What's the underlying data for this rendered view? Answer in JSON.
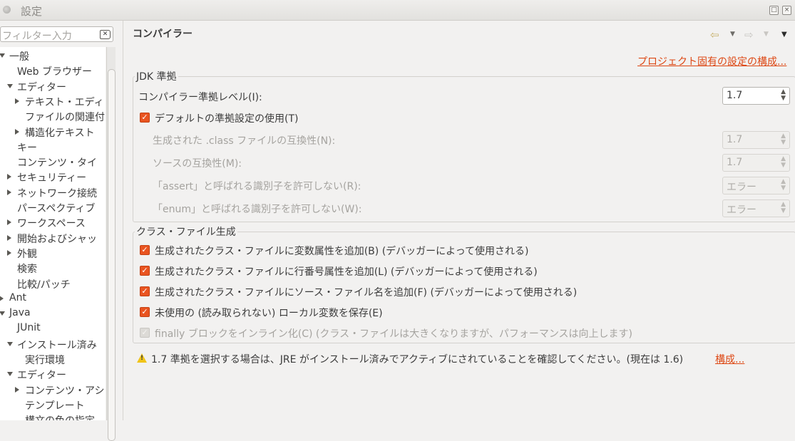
{
  "window": {
    "title": "設定"
  },
  "filter": {
    "placeholder": "フィルター入力"
  },
  "tree": [
    {
      "label": "一般",
      "arrow": "down"
    },
    {
      "label": "Web ブラウザー",
      "arrow": ""
    },
    {
      "label": "エディター",
      "arrow": "down"
    },
    {
      "label": "テキスト・エディ",
      "arrow": "right"
    },
    {
      "label": "ファイルの関連付",
      "arrow": ""
    },
    {
      "label": "構造化テキスト",
      "arrow": "right"
    },
    {
      "label": "キー",
      "arrow": ""
    },
    {
      "label": "コンテンツ・タイ",
      "arrow": ""
    },
    {
      "label": "セキュリティー",
      "arrow": "right"
    },
    {
      "label": "ネットワーク接続",
      "arrow": "right"
    },
    {
      "label": "パースペクティブ",
      "arrow": ""
    },
    {
      "label": "ワークスペース",
      "arrow": "right"
    },
    {
      "label": "開始およびシャッ",
      "arrow": "right"
    },
    {
      "label": "外観",
      "arrow": "right"
    },
    {
      "label": "検索",
      "arrow": ""
    },
    {
      "label": "比較/パッチ",
      "arrow": ""
    },
    {
      "label": "Ant",
      "arrow": "right"
    },
    {
      "label": "Java",
      "arrow": "down"
    },
    {
      "label": "JUnit",
      "arrow": ""
    },
    {
      "label": "インストール済み",
      "arrow": "down"
    },
    {
      "label": "実行環境",
      "arrow": ""
    },
    {
      "label": "エディター",
      "arrow": "down"
    },
    {
      "label": "コンテンツ・アシ",
      "arrow": "right"
    },
    {
      "label": "テンプレート",
      "arrow": ""
    },
    {
      "label": "構文の色の指定",
      "arrow": ""
    }
  ],
  "page": {
    "title": "コンパイラー",
    "project_link": "プロジェクト固有の設定の構成..."
  },
  "jdk": {
    "group_title": "JDK 準拠",
    "compliance_label": "コンパイラー準拠レベル(I):",
    "compliance_value": "1.7",
    "use_default_label": "デフォルトの準拠設定の使用(T)",
    "use_default_checked": true,
    "class_compat_label": "生成された .class ファイルの互換性(N):",
    "class_compat_value": "1.7",
    "source_compat_label": "ソースの互換性(M):",
    "source_compat_value": "1.7",
    "assert_label": "「assert」と呼ばれる識別子を許可しない(R):",
    "assert_value": "エラー",
    "enum_label": "「enum」と呼ばれる識別子を許可しない(W):",
    "enum_value": "エラー"
  },
  "classgen": {
    "group_title": "クラス・ファイル生成",
    "options": [
      {
        "label": "生成されたクラス・ファイルに変数属性を追加(B) (デバッガーによって使用される)",
        "checked": true,
        "disabled": false
      },
      {
        "label": "生成されたクラス・ファイルに行番号属性を追加(L) (デバッガーによって使用される)",
        "checked": true,
        "disabled": false
      },
      {
        "label": "生成されたクラス・ファイルにソース・ファイル名を追加(F) (デバッガーによって使用される)",
        "checked": true,
        "disabled": false
      },
      {
        "label": "未使用の (読み取られない) ローカル変数を保存(E)",
        "checked": true,
        "disabled": false
      },
      {
        "label": "finally ブロックをインライン化(C) (クラス・ファイルは大きくなりますが、パフォーマンスは向上します)",
        "checked": true,
        "disabled": true
      }
    ]
  },
  "warning": {
    "text": "1.7 準拠を選択する場合は、JRE がインストール済みでアクティブにされていることを確認してください。(現在は 1.6)",
    "link": "構成..."
  },
  "icons": {
    "back": "back-arrow-icon",
    "forward": "forward-arrow-icon",
    "menu": "view-menu-icon",
    "warning": "warning-icon"
  },
  "colors": {
    "accent": "#e95420",
    "link": "#dd4814"
  }
}
